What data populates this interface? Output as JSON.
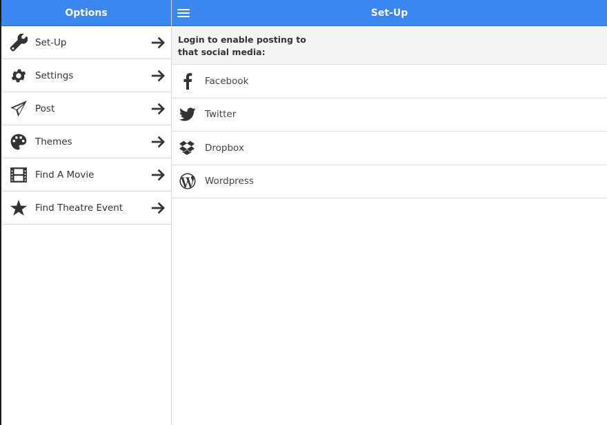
{
  "sidebar": {
    "title": "Options",
    "items": [
      {
        "label": "Set-Up",
        "icon": "wrench-icon"
      },
      {
        "label": "Settings",
        "icon": "gear-icon"
      },
      {
        "label": "Post",
        "icon": "paper-plane-icon"
      },
      {
        "label": "Themes",
        "icon": "palette-icon"
      },
      {
        "label": "Find A Movie",
        "icon": "film-icon"
      },
      {
        "label": "Find Theatre Event",
        "icon": "star-icon"
      }
    ]
  },
  "main": {
    "title": "Set-Up",
    "intro": "Login to enable posting to that social media:",
    "social": [
      {
        "label": "Facebook",
        "icon": "facebook-icon"
      },
      {
        "label": "Twitter",
        "icon": "twitter-icon"
      },
      {
        "label": "Dropbox",
        "icon": "dropbox-icon"
      },
      {
        "label": "Wordpress",
        "icon": "wordpress-icon"
      }
    ]
  },
  "colors": {
    "header_bg": "#3b86f0",
    "text": "#333333"
  }
}
